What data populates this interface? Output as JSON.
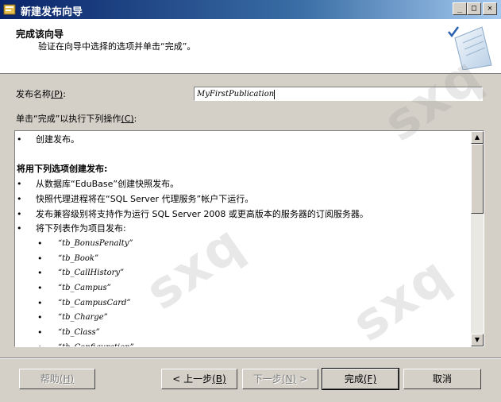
{
  "window": {
    "title": "新建发布向导",
    "minimize": "_",
    "maximize": "□",
    "close": "✕"
  },
  "header": {
    "title": "完成该向导",
    "subtitle": "验证在向导中选择的选项并单击“完成”。",
    "icon": "wizard-checkmark-icon"
  },
  "publication": {
    "name_label": "发布名称",
    "name_accel": "(P)",
    "name_suffix": ":",
    "name_value": "MyFirstPublication"
  },
  "actions_label": {
    "text": "单击“完成”以执行下列操作",
    "accel": "(C)",
    "suffix": ":"
  },
  "summary": {
    "lines": [
      {
        "kind": "bullet",
        "text": "创建发布。"
      },
      {
        "kind": "blank",
        "text": ""
      },
      {
        "kind": "heading",
        "text": "将用下列选项创建发布:"
      },
      {
        "kind": "bullet",
        "text": "从数据库“EduBase”创建快照发布。"
      },
      {
        "kind": "bullet",
        "text": "快照代理进程将在“SQL Server 代理服务”帐户下运行。"
      },
      {
        "kind": "bullet",
        "text": "发布兼容级别将支持作为运行 SQL Server 2008 或更高版本的服务器的订阅服务器。"
      },
      {
        "kind": "bullet",
        "text": "将下列表作为项目发布:"
      },
      {
        "kind": "subbullet",
        "text": "“tb_BonusPenalty”"
      },
      {
        "kind": "subbullet",
        "text": "“tb_Book”"
      },
      {
        "kind": "subbullet",
        "text": "“tb_CallHistory”"
      },
      {
        "kind": "subbullet",
        "text": "“tb_Campus”"
      },
      {
        "kind": "subbullet",
        "text": "“tb_CampusCard”"
      },
      {
        "kind": "subbullet",
        "text": "“tb_Charge”"
      },
      {
        "kind": "subbullet",
        "text": "“tb_Class”"
      },
      {
        "kind": "subbullet",
        "text": "“tb_Configuration”"
      }
    ],
    "scroll_position_fraction": 0.0
  },
  "buttons": {
    "help": {
      "label": "帮助",
      "accel": "(H)"
    },
    "back": {
      "label": "< 上一步",
      "accel": "(B)"
    },
    "next": {
      "label": "下一步",
      "accel": "(N)",
      "suffix": " >"
    },
    "finish": {
      "label": "完成",
      "accel": "(F)"
    },
    "cancel": {
      "label": "取消"
    }
  },
  "watermark": "sxq"
}
